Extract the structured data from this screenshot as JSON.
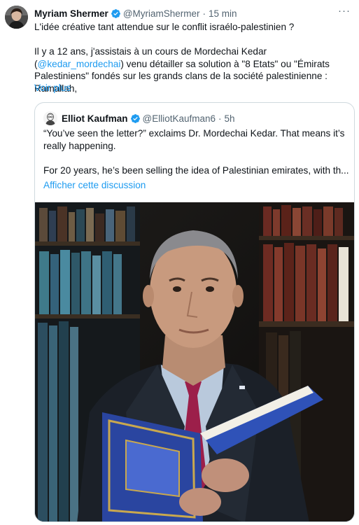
{
  "tweet": {
    "author_name": "Myriam Shermer",
    "handle": "@MyriamShermer",
    "separator": "·",
    "time": "15 min",
    "more_label": "···",
    "line1": "L'idée créative tant attendue sur le conflit israélo-palestinien ?",
    "para_part1": "Il y a 12 ans, j'assistais à un cours de Mordechai Kedar (",
    "mention": "@kedar_mordechai",
    "para_part2": ") venu détailler sa solution à \"8 Etats\" ou \"Émirats Palestiniens\" fondés sur les grands clans de la société palestinienne : Ramallah,",
    "show_more": "Voir plus"
  },
  "quote": {
    "author_name": "Elliot Kaufman",
    "handle": "@ElliotKaufman6",
    "separator": "·",
    "time": "5h",
    "p1": "“You’ve seen the letter?” exclaims Dr. Mordechai Kedar. That means it’s really happening.",
    "p2": "For 20 years, he’s been selling the idea of Palestinian emirates, with th...",
    "show_discussion": "Afficher cette discussion"
  },
  "colors": {
    "link": "#1d9bf0",
    "secondary_text": "#536471",
    "border": "#cfd9de",
    "verified": "#1d9bf0"
  }
}
